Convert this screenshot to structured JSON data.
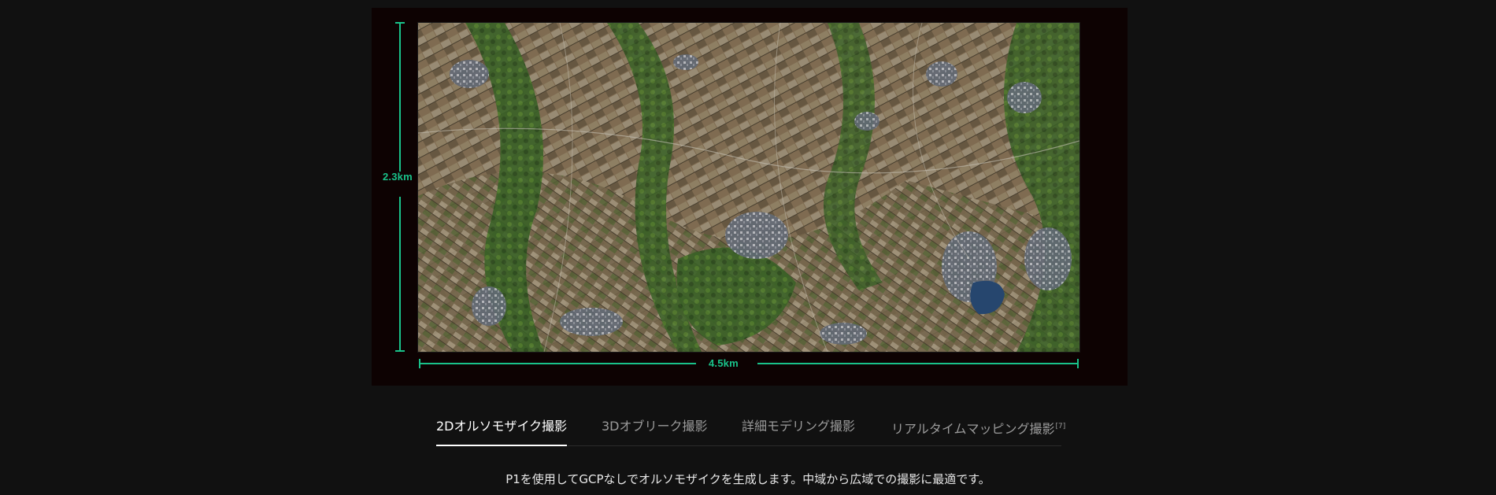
{
  "figure": {
    "height_label": "2.3km",
    "width_label": "4.5km",
    "image_description_icon": "aerial-orthomosaic-map"
  },
  "tabs": [
    {
      "label": "2Dオルソモザイク撮影",
      "active": true
    },
    {
      "label": "3Dオブリーク撮影",
      "active": false
    },
    {
      "label": "詳細モデリング撮影",
      "active": false
    },
    {
      "label": "リアルタイムマッピング撮影",
      "sup": "[7]",
      "active": false
    }
  ],
  "description": "P1を使用してGCPなしでオルソモザイクを生成します。中域から広域での撮影に最適です。",
  "colors": {
    "background": "#111111",
    "accent": "#19c28a",
    "tab_active": "#ffffff",
    "tab_inactive": "#9a9a9a"
  }
}
